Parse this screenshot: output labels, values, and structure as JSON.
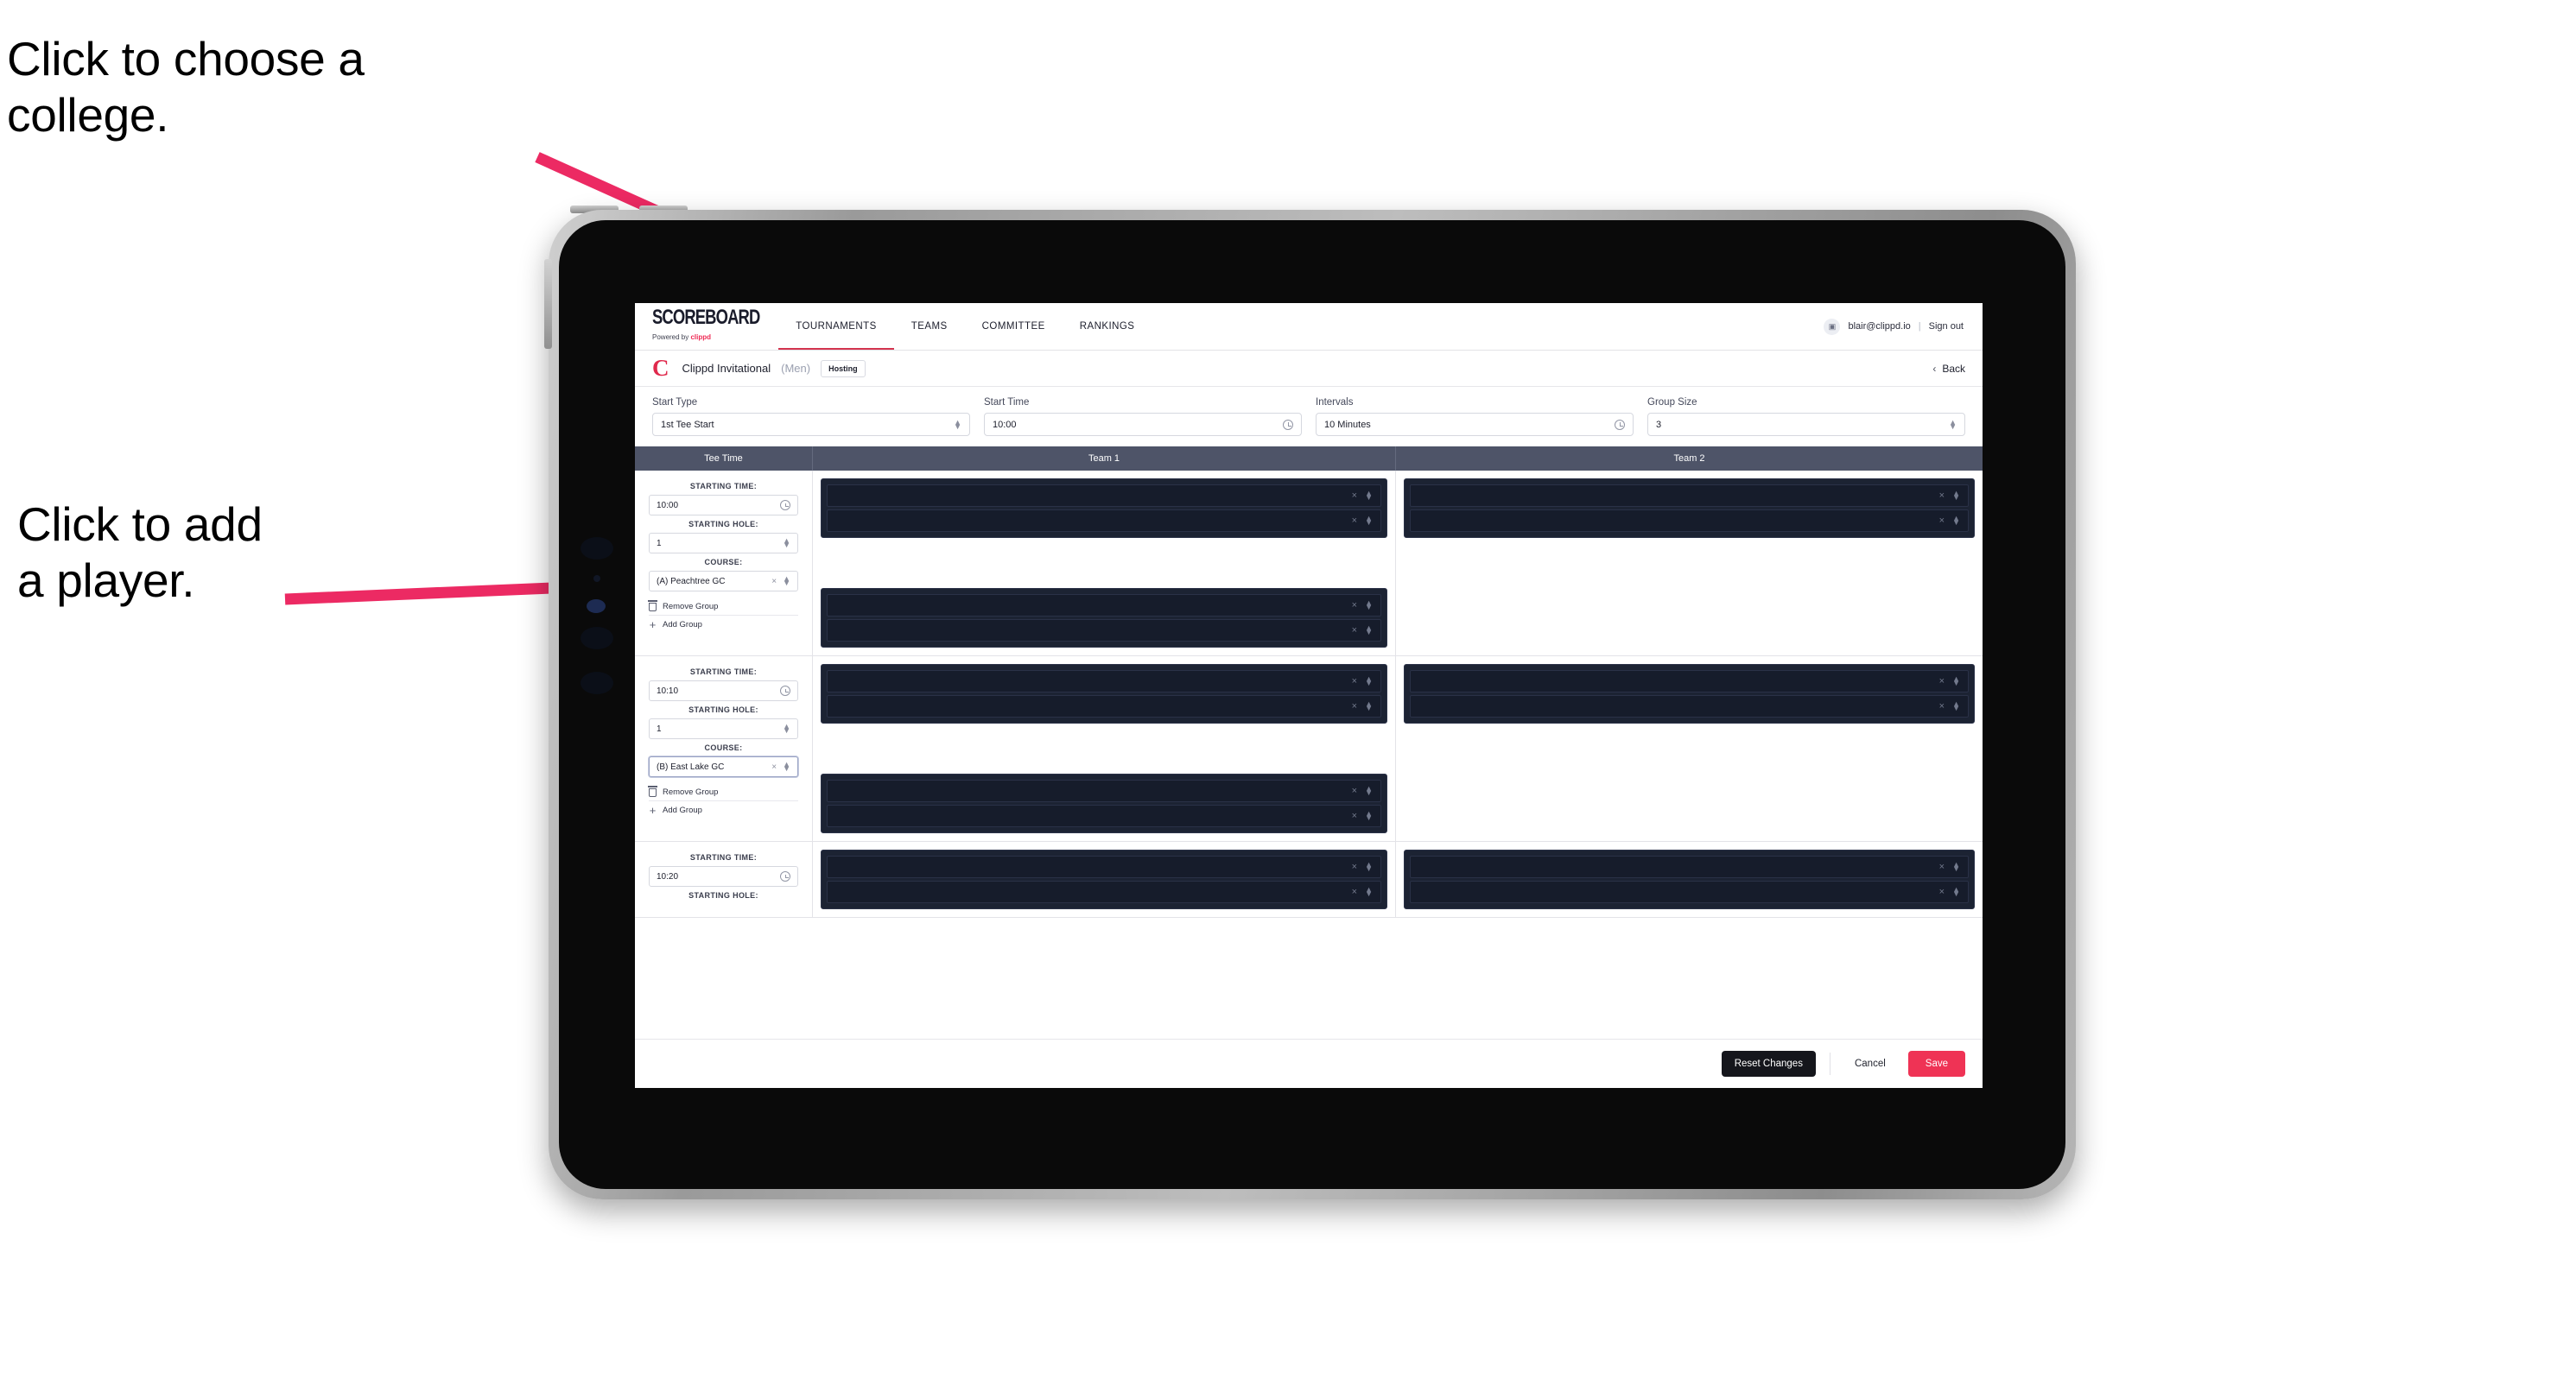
{
  "annotations": {
    "college": "Click to choose a\ncollege.",
    "player": "Click to add\na player.",
    "arrow_color": "#ec2a63"
  },
  "nav": {
    "brand_word": "SCOREBOARD",
    "brand_powered": "Powered by",
    "brand_clippd": "clippd",
    "items": [
      {
        "label": "TOURNAMENTS",
        "active": true
      },
      {
        "label": "TEAMS",
        "active": false
      },
      {
        "label": "COMMITTEE",
        "active": false
      },
      {
        "label": "RANKINGS",
        "active": false
      }
    ],
    "avatar_glyph": "▣",
    "user_email": "blair@clippd.io",
    "separator": "|",
    "sign_out": "Sign out"
  },
  "tournament": {
    "logo_letter": "C",
    "name": "Clippd Invitational",
    "gender": "(Men)",
    "badge": "Hosting",
    "back_chevron": "‹",
    "back_label": "Back"
  },
  "form": {
    "fields": [
      {
        "label": "Start Type",
        "value": "1st Tee Start",
        "icon": "stepper-icon"
      },
      {
        "label": "Start Time",
        "value": "10:00",
        "icon": "clock-icon"
      },
      {
        "label": "Intervals",
        "value": "10 Minutes",
        "icon": "clock-icon"
      },
      {
        "label": "Group Size",
        "value": "3",
        "icon": "stepper-icon"
      }
    ]
  },
  "table": {
    "headers": {
      "tee_time": "Tee Time",
      "team1": "Team 1",
      "team2": "Team 2"
    },
    "labels": {
      "starting_time": "STARTING TIME:",
      "starting_hole": "STARTING HOLE:",
      "course": "COURSE:",
      "remove_group": "Remove Group",
      "add_group": "Add Group"
    },
    "rows": [
      {
        "starting_time": "10:00",
        "starting_hole": "1",
        "course": "(A) Peachtree GC",
        "course_focused": false,
        "team1_blocks": 2,
        "team2_blocks": 1,
        "slots_per_block": 2
      },
      {
        "starting_time": "10:10",
        "starting_hole": "1",
        "course": "(B) East Lake GC",
        "course_focused": true,
        "team1_blocks": 2,
        "team2_blocks": 1,
        "slots_per_block": 2
      },
      {
        "starting_time": "10:20",
        "starting_hole": "",
        "course": "",
        "course_focused": false,
        "team1_blocks": 1,
        "team2_blocks": 1,
        "slots_per_block": 2
      }
    ]
  },
  "footer": {
    "reset": "Reset Changes",
    "cancel": "Cancel",
    "save": "Save"
  },
  "colors": {
    "accent_pink": "#ef3355",
    "nav_underline": "#d4344f",
    "table_header_bg": "#4e5468",
    "player_block_bg": "#1c2333",
    "player_slot_bg": "#161c2b",
    "reset_btn_bg": "#15161c"
  }
}
